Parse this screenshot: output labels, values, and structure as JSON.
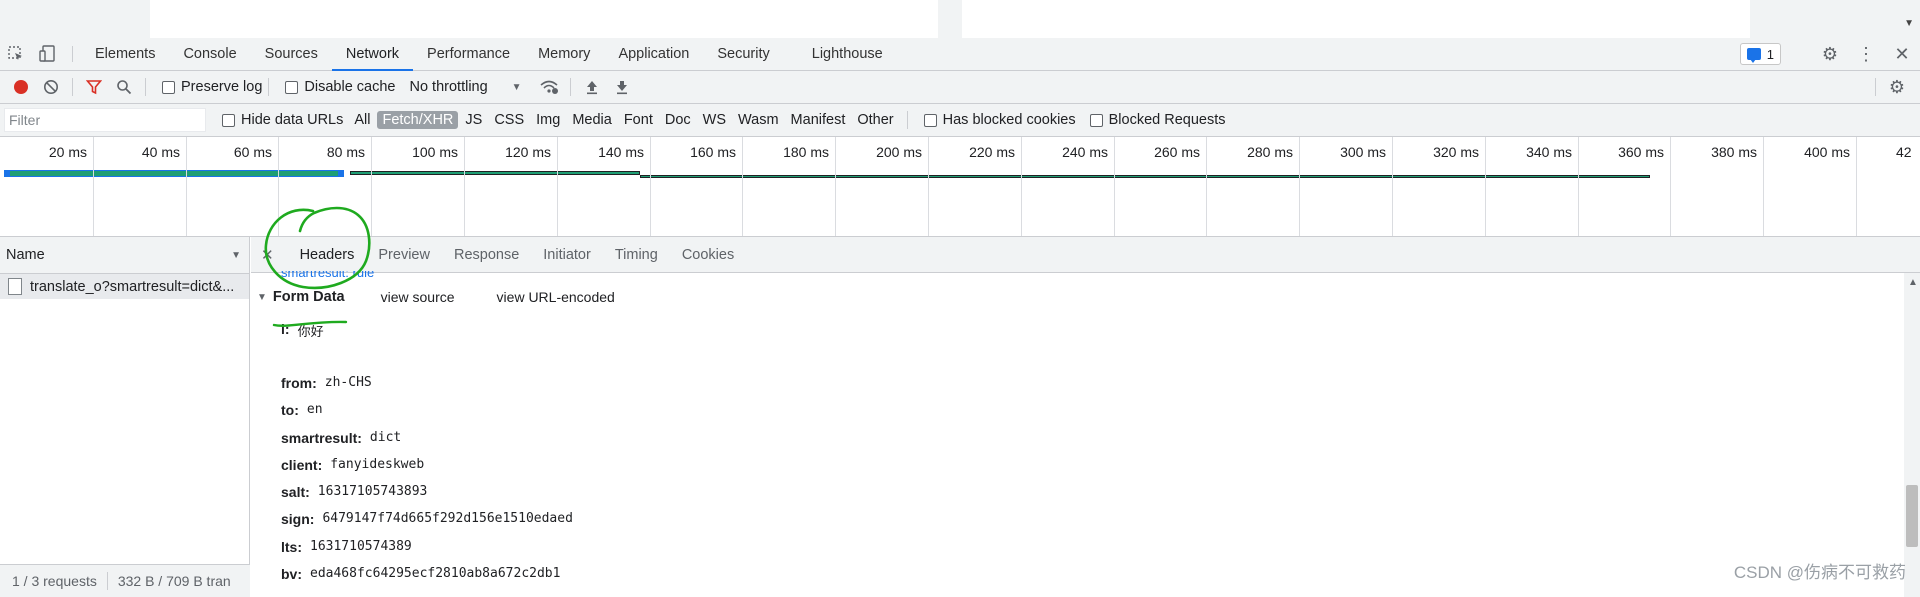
{
  "devtools": {
    "tabs": [
      "Elements",
      "Console",
      "Sources",
      "Network",
      "Performance",
      "Memory",
      "Application",
      "Security",
      "Lighthouse"
    ],
    "active_tab": "Network",
    "issues_count": "1"
  },
  "network_toolbar": {
    "preserve_log": "Preserve log",
    "disable_cache": "Disable cache",
    "throttling": "No throttling"
  },
  "filter_bar": {
    "placeholder": "Filter",
    "hide_data_urls": "Hide data URLs",
    "types": [
      "All",
      "Fetch/XHR",
      "JS",
      "CSS",
      "Img",
      "Media",
      "Font",
      "Doc",
      "WS",
      "Wasm",
      "Manifest",
      "Other"
    ],
    "selected_type": "Fetch/XHR",
    "has_blocked_cookies": "Has blocked cookies",
    "blocked_requests": "Blocked Requests"
  },
  "timeline": {
    "ticks": [
      "20 ms",
      "40 ms",
      "60 ms",
      "80 ms",
      "100 ms",
      "120 ms",
      "140 ms",
      "160 ms",
      "180 ms",
      "200 ms",
      "220 ms",
      "240 ms",
      "260 ms",
      "280 ms",
      "300 ms",
      "320 ms",
      "340 ms",
      "360 ms",
      "380 ms",
      "400 ms",
      "42"
    ]
  },
  "request_list": {
    "column": "Name",
    "rows": [
      "translate_o?smartresult=dict&..."
    ],
    "status_requests": "1 / 3 requests",
    "status_transfer": "332 B / 709 B tran"
  },
  "details": {
    "tabs": [
      "Headers",
      "Preview",
      "Response",
      "Initiator",
      "Timing",
      "Cookies"
    ],
    "active_tab": "Headers",
    "clipped_line": "smartresult: rule",
    "form_data": {
      "title": "Form Data",
      "view_source": "view source",
      "view_url_encoded": "view URL-encoded",
      "fields": [
        {
          "k": "i:",
          "v": "你好"
        },
        {
          "k": "from:",
          "v": "zh-CHS"
        },
        {
          "k": "to:",
          "v": "en"
        },
        {
          "k": "smartresult:",
          "v": "dict"
        },
        {
          "k": "client:",
          "v": "fanyideskweb"
        },
        {
          "k": "salt:",
          "v": "16317105743893"
        },
        {
          "k": "sign:",
          "v": "6479147f74d665f292d156e1510edaed"
        },
        {
          "k": "lts:",
          "v": "1631710574389"
        },
        {
          "k": "bv:",
          "v": "eda468fc64295ecf2810ab8a672c2db1"
        }
      ]
    }
  },
  "watermark": "CSDN @伤病不可救药",
  "colors": {
    "accent": "#1a73e8",
    "record": "#d93025",
    "annotation": "#1faa1f"
  }
}
